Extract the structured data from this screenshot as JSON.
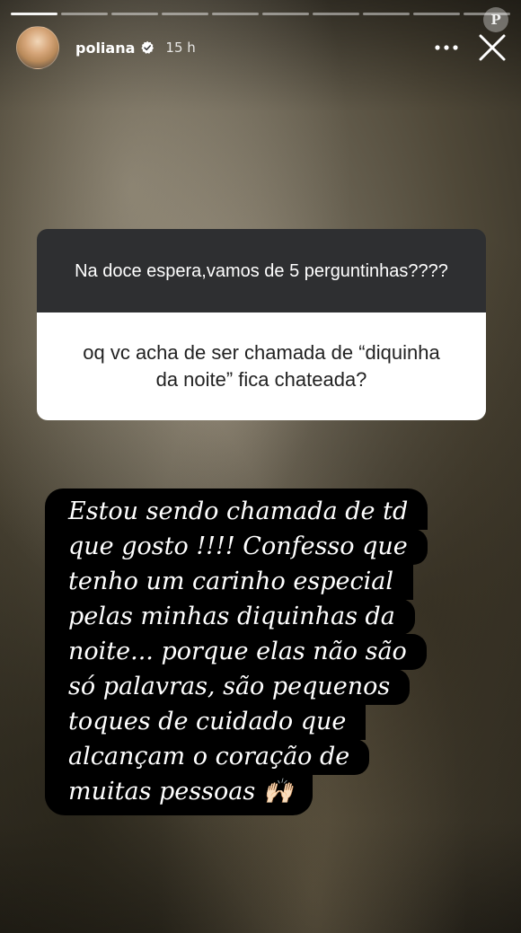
{
  "story": {
    "progress_segments": 10,
    "progress_done": 1
  },
  "header": {
    "username": "poliana",
    "timestamp": "15 h",
    "avatar_icon": "avatar",
    "verified_icon": "verified-badge-icon",
    "more_icon": "more-horizontal-icon",
    "close_icon": "close-icon"
  },
  "watermark": {
    "letter": "P"
  },
  "question_sticker": {
    "prompt": "Na doce espera,vamos de 5 perguntinhas????",
    "question": "oq vc acha de ser chamada de “diquinha da noite” fica chateada?"
  },
  "answer": {
    "lines": [
      "Estou sendo chamada de td",
      "que gosto !!!! Confesso que",
      "tenho um carinho especial",
      "pelas minhas diquinhas da",
      "noite... porque elas não são",
      "só palavras, são pequenos",
      "toques de cuidado que",
      "alcançam o coração de",
      "muitas pessoas 🙌🏻"
    ]
  },
  "colors": {
    "sticker_top": "#2e2f31",
    "sticker_bottom": "#ffffff",
    "answer_bg": "#000000",
    "text_light": "#ffffff"
  }
}
